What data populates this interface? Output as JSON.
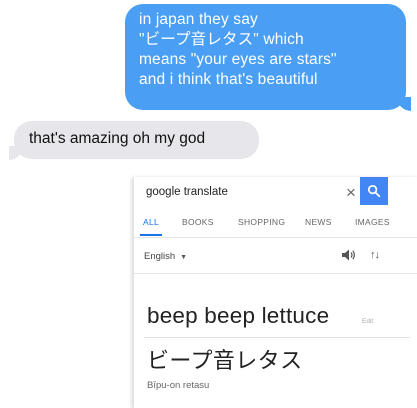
{
  "messages": {
    "sent": {
      "lines": [
        "in japan they say",
        "\"ビープ音レタス\" which",
        "means \"your eyes are stars\"",
        "and i think that's beautiful"
      ],
      "color": "#4a9ff5"
    },
    "received": {
      "text": "that's amazing oh my god",
      "color": "#e6e6eb"
    }
  },
  "translate": {
    "query": "google translate",
    "clear_icon": "close-icon",
    "search_icon": "search-icon",
    "accent": "#4285f4",
    "tabs": [
      "ALL",
      "BOOKS",
      "SHOPPING",
      "NEWS",
      "IMAGES"
    ],
    "active_tab": "ALL",
    "source_lang": "English",
    "speaker_icon": "speaker-icon",
    "swap_icon": "swap-icon",
    "source_text": "beep beep lettuce",
    "edit_label": "Edit",
    "result_text": "ビープ音レタス",
    "romanization": "Bīpu-on retasu"
  }
}
